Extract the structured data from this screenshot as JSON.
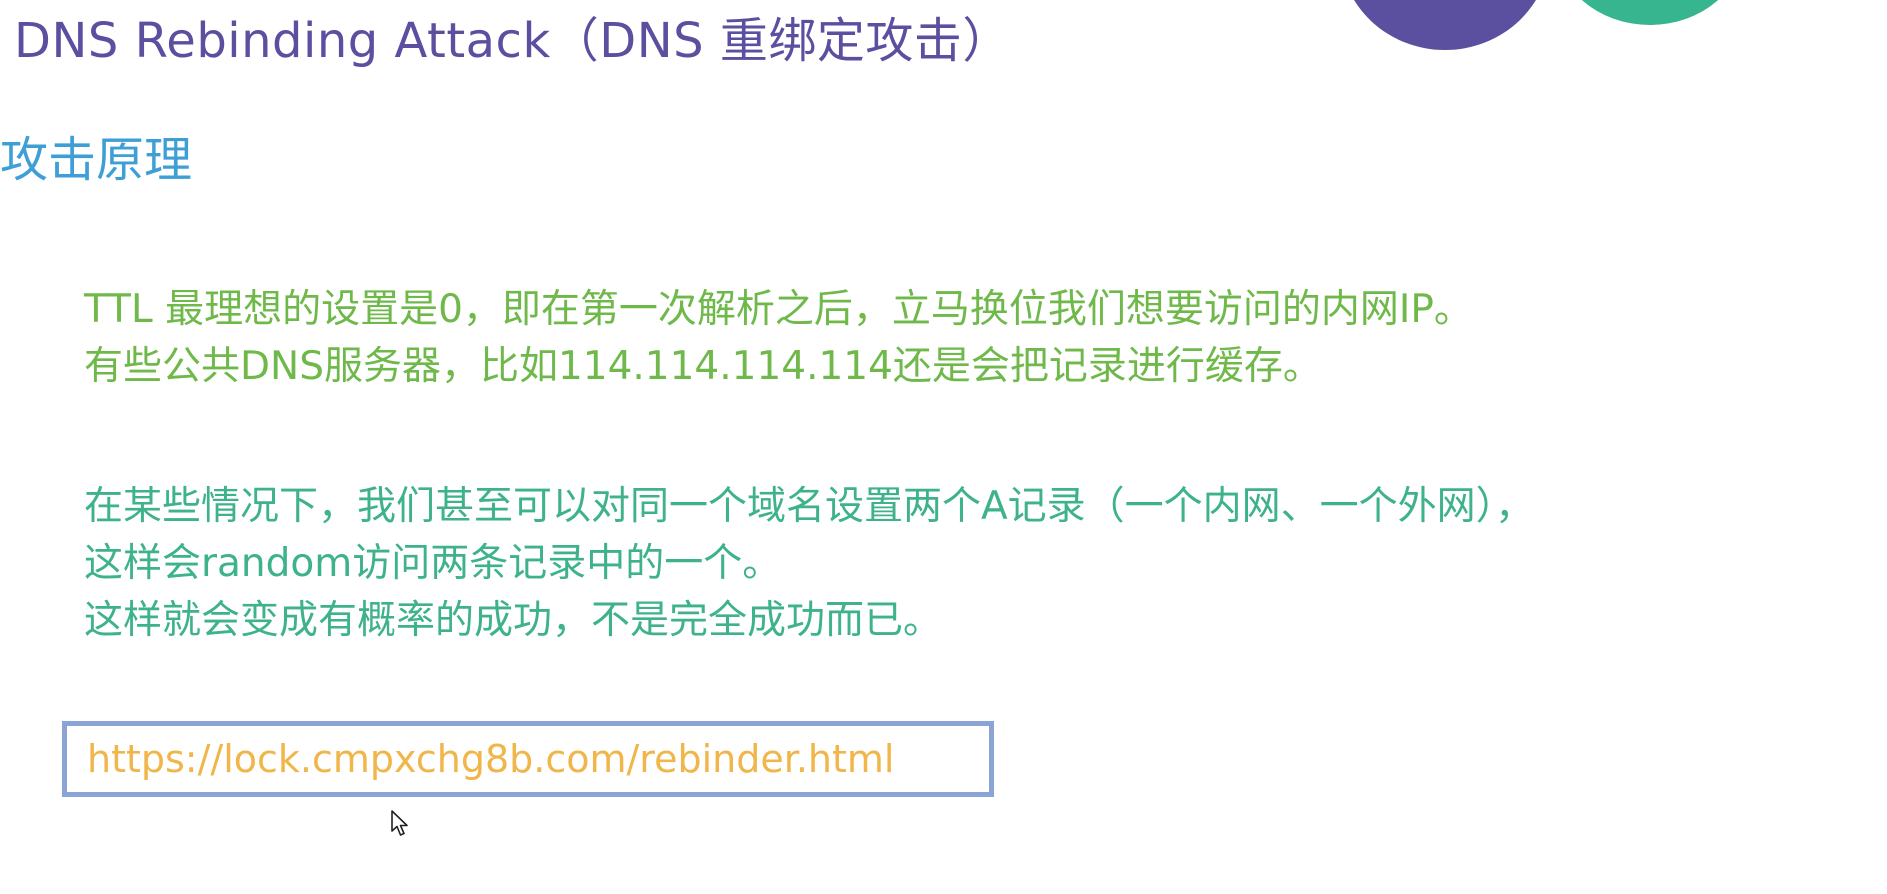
{
  "slide": {
    "title": "DNS Rebinding Attack（DNS 重绑定攻击）",
    "subtitle": "攻击原理",
    "paragraph1": [
      "TTL 最理想的设置是0，即在第一次解析之后，立马换位我们想要访问的内网IP。",
      "有些公共DNS服务器，比如114.114.114.114还是会把记录进行缓存。"
    ],
    "paragraph2": [
      "在某些情况下，我们甚至可以对同一个域名设置两个A记录（一个内网、一个外网），",
      "这样会random访问两条记录中的一个。",
      "这样就会变成有概率的成功，不是完全成功而已。"
    ],
    "url": "https://lock.cmpxchg8b.com/rebinder.html"
  },
  "colors": {
    "title": "#5b4fa0",
    "subtitle": "#3e9fd6",
    "paragraph1": "#6fb84a",
    "paragraph2": "#3db28b",
    "url_text": "#f0b64a",
    "url_border": "#8ba4d6",
    "decoration_purple": "#5b4fa0",
    "decoration_green": "#37b58f"
  },
  "icons": {
    "cursor": "mouse-pointer-icon"
  }
}
